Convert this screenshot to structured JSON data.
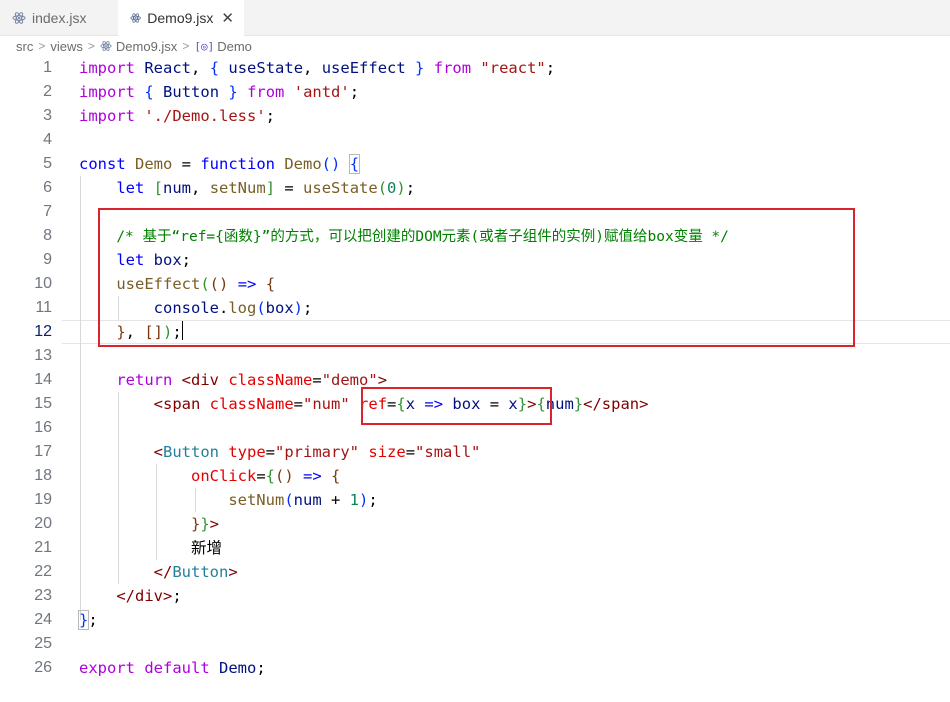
{
  "tabs": [
    {
      "label": "index.jsx",
      "icon": "react-icon",
      "active": false
    },
    {
      "label": "Demo9.jsx",
      "icon": "react-icon",
      "active": true,
      "close": "✕"
    }
  ],
  "breadcrumb": {
    "items": [
      "src",
      "views",
      "Demo9.jsx",
      "Demo"
    ],
    "separator": ">"
  },
  "editor": {
    "line_numbers": [
      "1",
      "2",
      "3",
      "4",
      "5",
      "6",
      "7",
      "8",
      "9",
      "10",
      "11",
      "12",
      "13",
      "14",
      "15",
      "16",
      "17",
      "18",
      "19",
      "20",
      "21",
      "22",
      "23",
      "24",
      "25",
      "26"
    ],
    "active_line": "12",
    "comment_text": "/* 基于“ref={函数}”的方式，可以把创建的DOM元素(或者子组件的实例)赋值给box变量 */",
    "button_text": "新增",
    "highlight_color": "#d9232d"
  }
}
